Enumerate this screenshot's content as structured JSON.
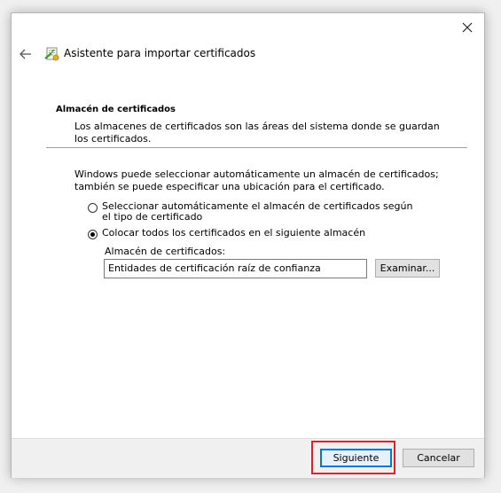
{
  "wizard": {
    "title": "Asistente para importar certificados"
  },
  "section": {
    "title": "Almacén de certificados",
    "description": "Los almacenes de certificados son las áreas del sistema donde se guardan los certificados."
  },
  "intro": "Windows puede seleccionar automáticamente un almacén de certificados; también se puede especificar una ubicación para el certificado.",
  "options": [
    {
      "label": "Seleccionar automáticamente el almacén de certificados según el tipo de certificado",
      "checked": false
    },
    {
      "label": "Colocar todos los certificados en el siguiente almacén",
      "checked": true
    }
  ],
  "store": {
    "label": "Almacén de certificados:",
    "value": "Entidades de certificación raíz de confianza",
    "browse_label": "Examinar..."
  },
  "footer": {
    "next_label": "Siguiente",
    "cancel_label": "Cancelar"
  },
  "colors": {
    "highlight": "#e0202a",
    "focus": "#0078d7"
  }
}
